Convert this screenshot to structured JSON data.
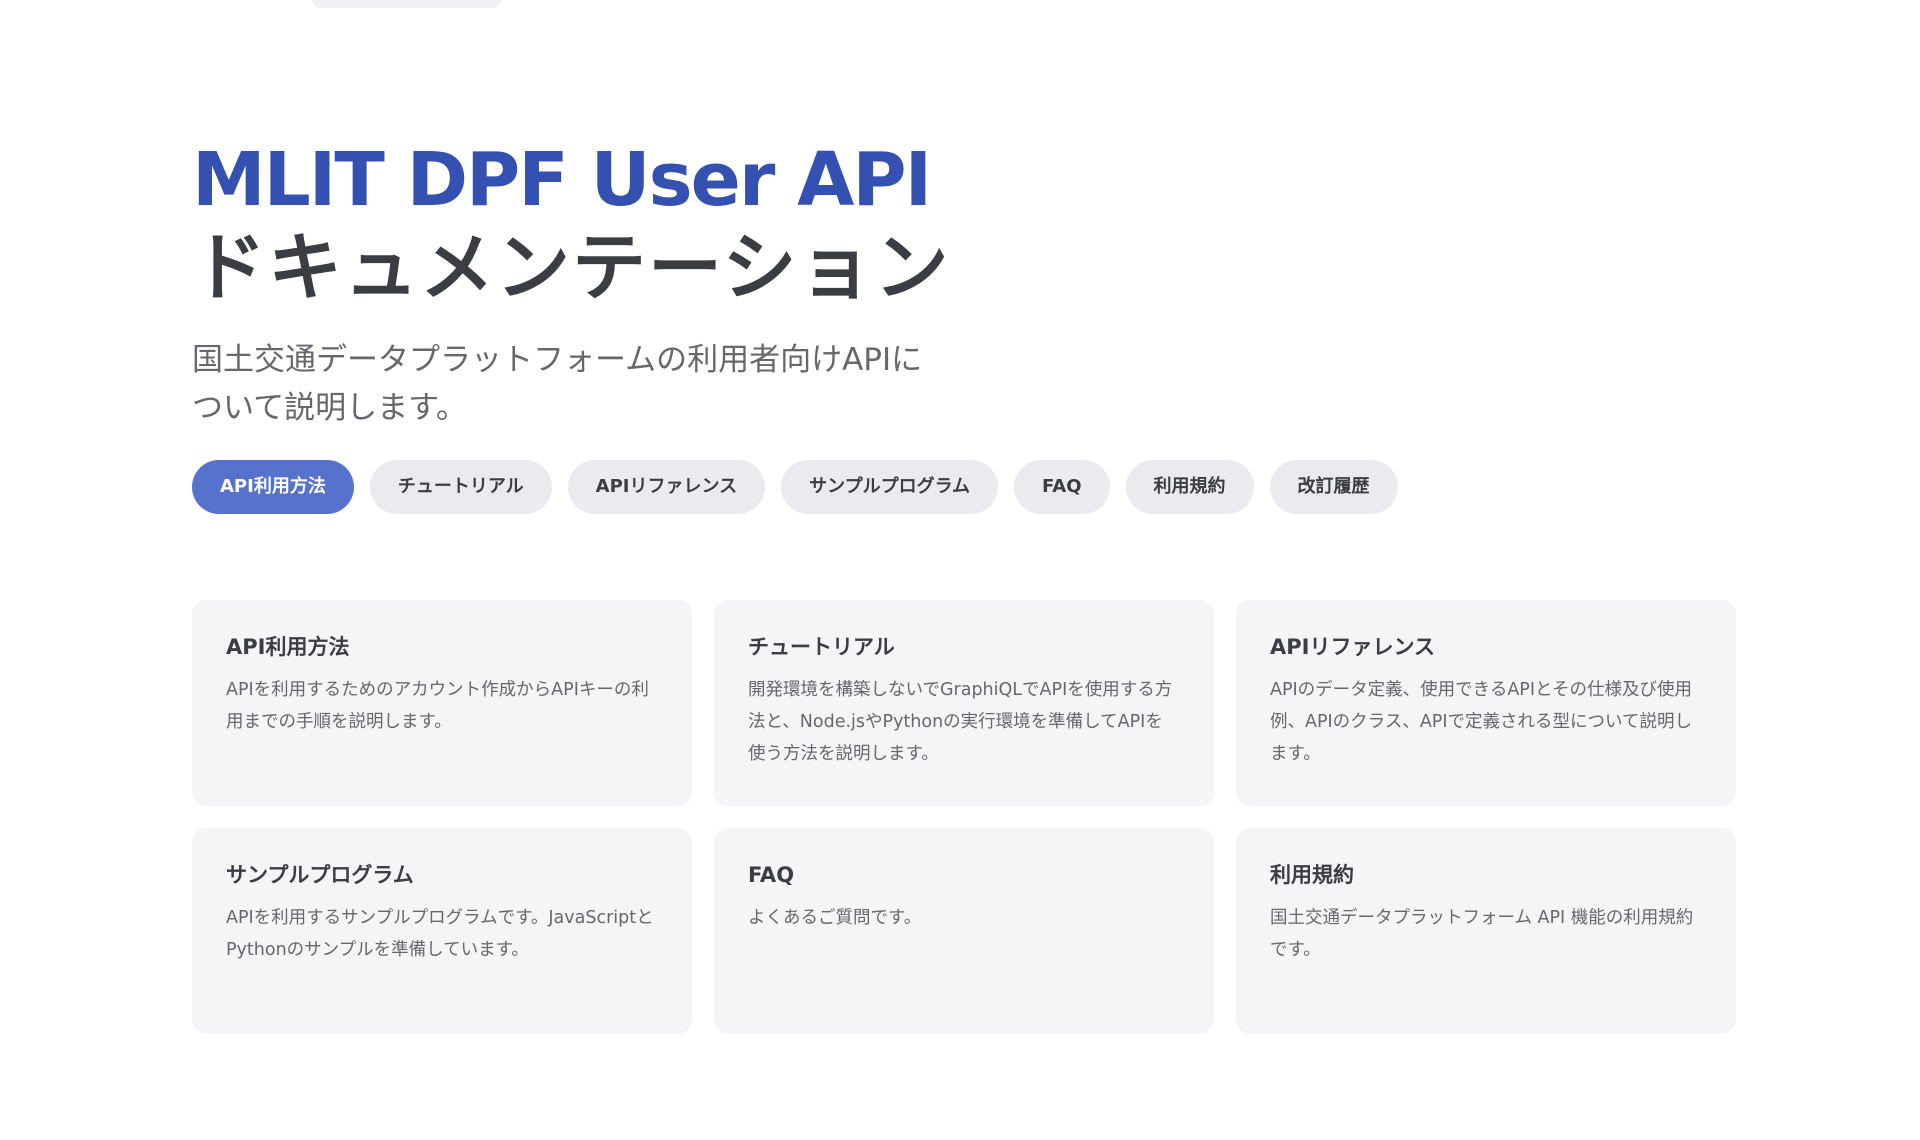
{
  "hero": {
    "name": "MLIT DPF User API",
    "text": "ドキュメンテーション",
    "tagline": "国土交通データプラットフォームの利用者向けAPIについて説明します。"
  },
  "actions": [
    {
      "label": "API利用方法",
      "theme": "brand"
    },
    {
      "label": "チュートリアル",
      "theme": "alt"
    },
    {
      "label": "APIリファレンス",
      "theme": "alt"
    },
    {
      "label": "サンプルプログラム",
      "theme": "alt"
    },
    {
      "label": "FAQ",
      "theme": "alt"
    },
    {
      "label": "利用規約",
      "theme": "alt"
    },
    {
      "label": "改訂履歴",
      "theme": "alt"
    }
  ],
  "features": [
    {
      "title": "API利用方法",
      "details": "APIを利用するためのアカウント作成からAPIキーの利用までの手順を説明します。"
    },
    {
      "title": "チュートリアル",
      "details": "開発環境を構築しないでGraphiQLでAPIを使用する方法と、Node.jsやPythonの実行環境を準備してAPIを使う方法を説明します。"
    },
    {
      "title": "APIリファレンス",
      "details": "APIのデータ定義、使用できるAPIとその仕様及び使用例、APIのクラス、APIで定義される型について説明します。"
    },
    {
      "title": "サンプルプログラム",
      "details": "APIを利用するサンプルプログラムです。JavaScriptとPythonのサンプルを準備しています。"
    },
    {
      "title": "FAQ",
      "details": "よくあるご質問です。"
    },
    {
      "title": "利用規約",
      "details": "国土交通データプラットフォーム API 機能の利用規約です。"
    }
  ],
  "colors": {
    "brand": "#3451b2",
    "brand_button": "#5672cd",
    "text": "#3c3c43",
    "muted_text": "#67676c",
    "alt_button_bg": "#ebebef",
    "card_bg": "#f5f5f7"
  }
}
